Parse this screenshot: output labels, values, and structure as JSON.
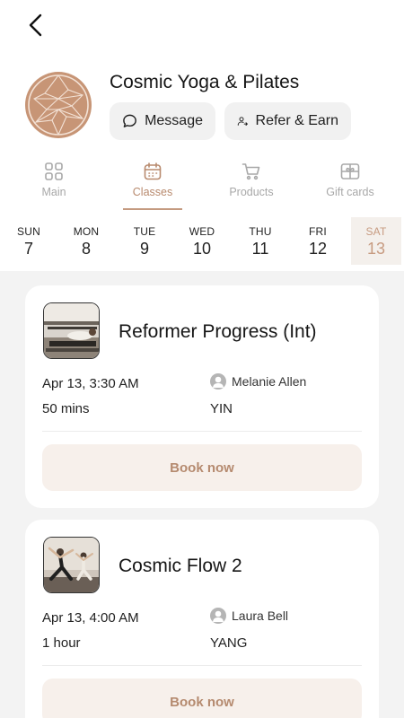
{
  "nav": {
    "back_icon": "chevron-left-icon"
  },
  "studio": {
    "name": "Cosmic Yoga & Pilates",
    "logo": "studio-logo",
    "message_label": "Message",
    "refer_label": "Refer & Earn",
    "brand_color": "#c79576"
  },
  "tabs": [
    {
      "label": "Main",
      "icon": "grid-icon",
      "active": false
    },
    {
      "label": "Classes",
      "icon": "calendar-icon",
      "active": true
    },
    {
      "label": "Products",
      "icon": "cart-icon",
      "active": false
    },
    {
      "label": "Gift cards",
      "icon": "gift-card-icon",
      "active": false
    }
  ],
  "days": [
    {
      "name": "SUN",
      "num": "7"
    },
    {
      "name": "MON",
      "num": "8"
    },
    {
      "name": "TUE",
      "num": "9"
    },
    {
      "name": "WED",
      "num": "10"
    },
    {
      "name": "THU",
      "num": "11"
    },
    {
      "name": "FRI",
      "num": "12"
    },
    {
      "name": "SAT",
      "num": "13",
      "selected": true
    }
  ],
  "classes": [
    {
      "title": "Reformer Progress (Int)",
      "datetime": "Apr 13, 3:30 AM",
      "duration": "50 mins",
      "instructor": "Melanie Allen",
      "tag": "YIN",
      "book_label": "Book now"
    },
    {
      "title": "Cosmic Flow 2",
      "datetime": "Apr 13, 4:00 AM",
      "duration": "1 hour",
      "instructor": "Laura Bell",
      "tag": "YANG",
      "book_label": "Book now"
    }
  ],
  "colors": {
    "accent": "#c49a80",
    "book_bg": "#f7f0eb",
    "list_bg": "#f3f3f3"
  }
}
